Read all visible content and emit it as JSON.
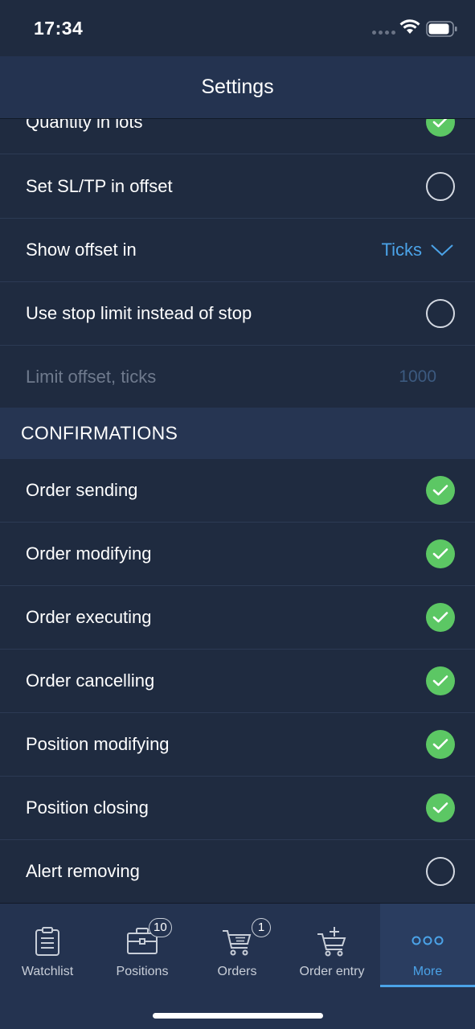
{
  "status": {
    "time": "17:34"
  },
  "header": {
    "title": "Settings"
  },
  "rows_top": [
    {
      "label": "Quantity in lots",
      "control": "checked"
    },
    {
      "label": "Set SL/TP in offset",
      "control": "unchecked"
    },
    {
      "label": "Show offset in",
      "control": "dropdown",
      "value": "Ticks"
    },
    {
      "label": "Use stop limit instead of stop",
      "control": "unchecked"
    },
    {
      "label": "Limit offset, ticks",
      "control": "value",
      "value": "1000",
      "disabled": true
    }
  ],
  "confirmations": {
    "header": "CONFIRMATIONS",
    "items": [
      {
        "label": "Order sending",
        "checked": true
      },
      {
        "label": "Order modifying",
        "checked": true
      },
      {
        "label": "Order executing",
        "checked": true
      },
      {
        "label": "Order cancelling",
        "checked": true
      },
      {
        "label": "Position modifying",
        "checked": true
      },
      {
        "label": "Position closing",
        "checked": true
      },
      {
        "label": "Alert removing",
        "checked": false
      }
    ]
  },
  "tabbar": {
    "tabs": [
      {
        "label": "Watchlist",
        "icon": "clipboard-icon"
      },
      {
        "label": "Positions",
        "icon": "briefcase-icon",
        "badge": "10"
      },
      {
        "label": "Orders",
        "icon": "cart-list-icon",
        "badge": "1"
      },
      {
        "label": "Order entry",
        "icon": "cart-add-icon"
      },
      {
        "label": "More",
        "icon": "more-dots-icon",
        "active": true
      }
    ]
  },
  "colors": {
    "background": "#1f2b40",
    "accent": "#4ba3e8",
    "check_on": "#5cc764"
  }
}
